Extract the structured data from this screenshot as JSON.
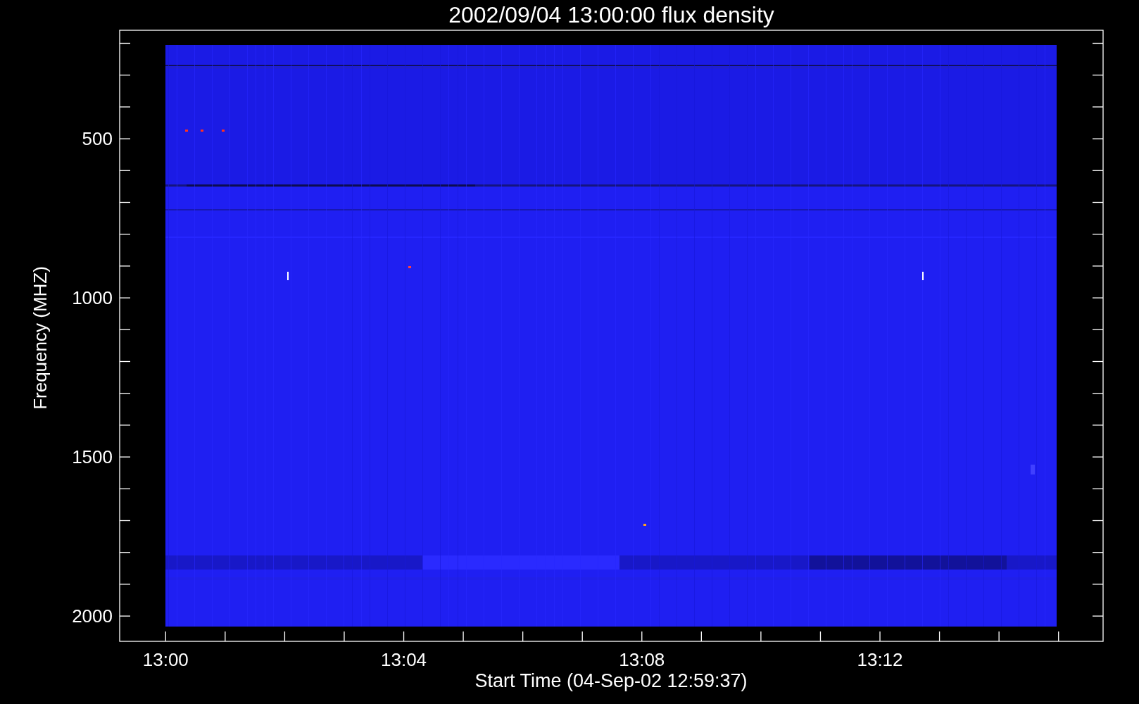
{
  "plot": {
    "title": "2002/09/04 13:00:00 flux density",
    "x_axis": {
      "label": "Start Time (04-Sep-02 12:59:37)",
      "ticks": [
        "13:00",
        "13:04",
        "13:08",
        "13:12"
      ]
    },
    "y_axis": {
      "label": "Frequency (MHZ)",
      "ticks": [
        "500",
        "1000",
        "1500",
        "2000"
      ]
    }
  }
}
